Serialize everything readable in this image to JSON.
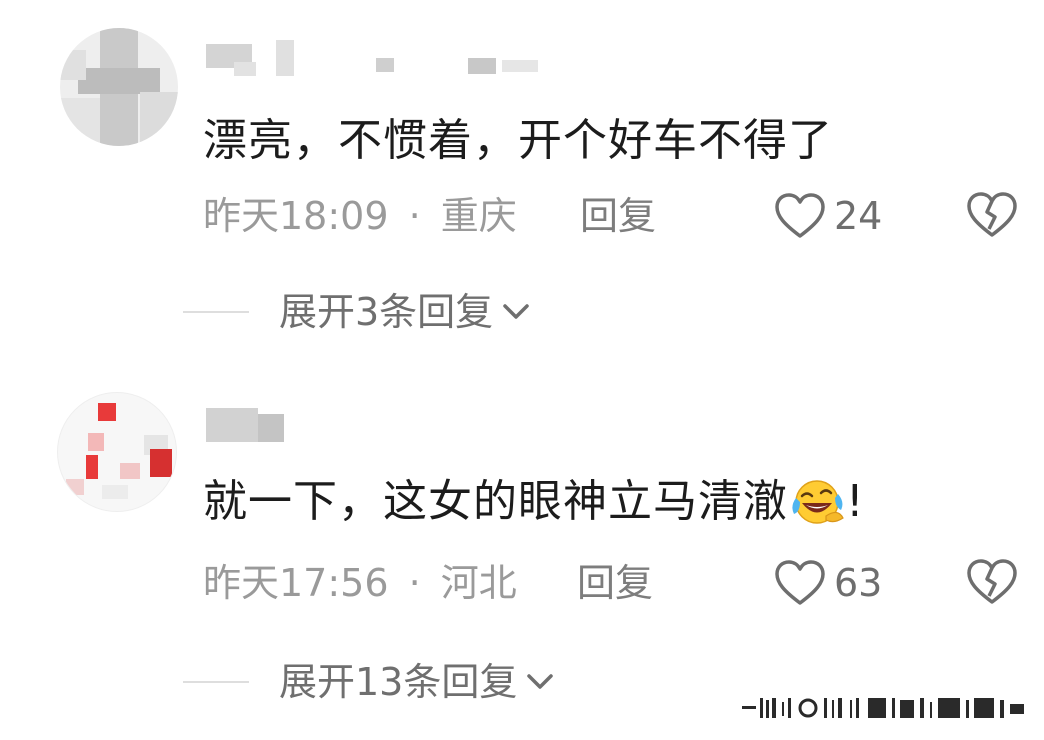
{
  "comments": [
    {
      "text": "漂亮，不惯着，开个好车不得了",
      "text_after_emoji": "",
      "time": "昨天18:09",
      "separator": "·",
      "location": "重庆",
      "reply_label": "回复",
      "likes": "24",
      "expand_label": "展开3条回复"
    },
    {
      "text": "就一下，这女的眼神立马清澈",
      "text_after_emoji": "!",
      "time": "昨天17:56",
      "separator": "·",
      "location": "河北",
      "reply_label": "回复",
      "likes": "63",
      "expand_label": "展开13条回复"
    }
  ],
  "icons": {
    "like": "heart-outline-icon",
    "dislike": "broken-heart-icon",
    "expand": "chevron-down-icon",
    "emoji": "laughing-crying-emoji"
  },
  "colors": {
    "text": "#1c1c1c",
    "meta": "#9a9a9a",
    "icon": "#6e6e6e"
  }
}
